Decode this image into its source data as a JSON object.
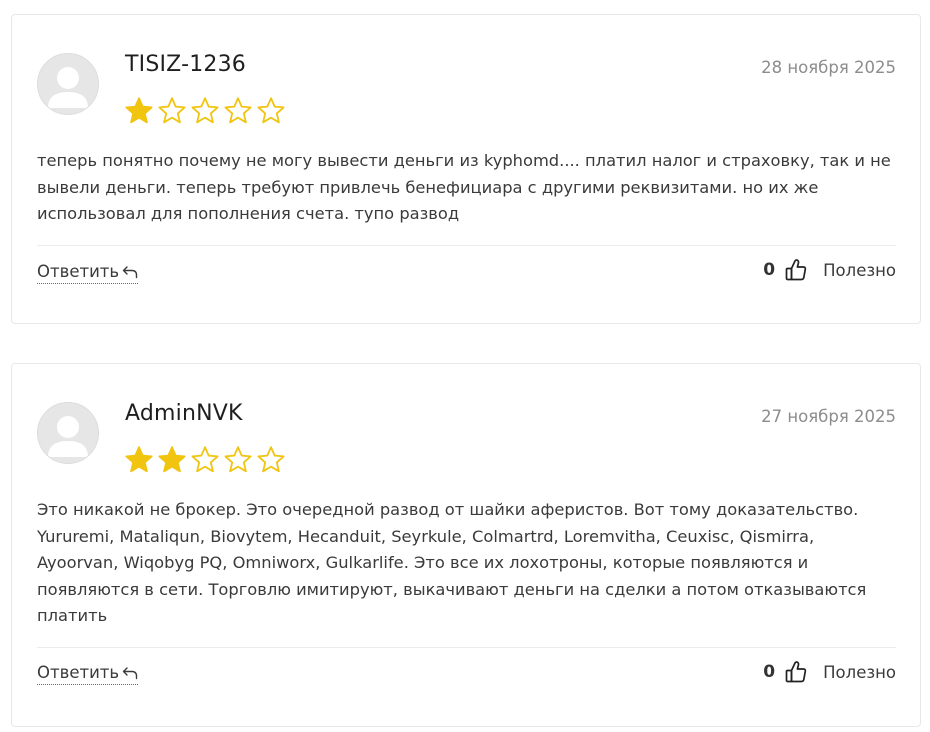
{
  "reviews": [
    {
      "author": "TISIZ-1236",
      "date": "28 ноября 2025",
      "rating": 1,
      "max_rating": 5,
      "text": "теперь понятно почему не могу вывести деньги из kyphomd.... платил налог и страховку, так и не вывели деньги. теперь требуют привлечь бенефициара с другими реквизитами. но их же использовал для пополнения счета. тупо развод",
      "reply_label": "Ответить",
      "helpful_count": "0",
      "helpful_label": "Полезно"
    },
    {
      "author": "AdminNVK",
      "date": "27 ноября 2025",
      "rating": 2,
      "max_rating": 5,
      "text": "Это никакой не брокер. Это очередной развод от шайки аферистов. Вот тому доказательство. Yururemi, Mataliqun, Biovytem, Hecanduit, Seyrkule, Colmartrd, Loremvitha, Ceuxisc, Qismirra, Ayoorvan, Wiqobyg PQ, Omniworx, Gulkarlife. Это все их лохотроны, которые появляются и появляются в сети. Торговлю имитируют, выкачивают деньги на сделки а потом отказываются платить",
      "reply_label": "Ответить",
      "helpful_count": "0",
      "helpful_label": "Полезно"
    }
  ],
  "icons": {
    "avatar": "user-placeholder-icon",
    "star_filled": "star-filled-icon",
    "star_empty": "star-outline-icon",
    "reply": "reply-arrow-icon",
    "helpful": "thumbs-up-icon"
  },
  "colors": {
    "star": "#f1c40f",
    "border": "#e8e8e8",
    "date": "#8c8c8c"
  }
}
